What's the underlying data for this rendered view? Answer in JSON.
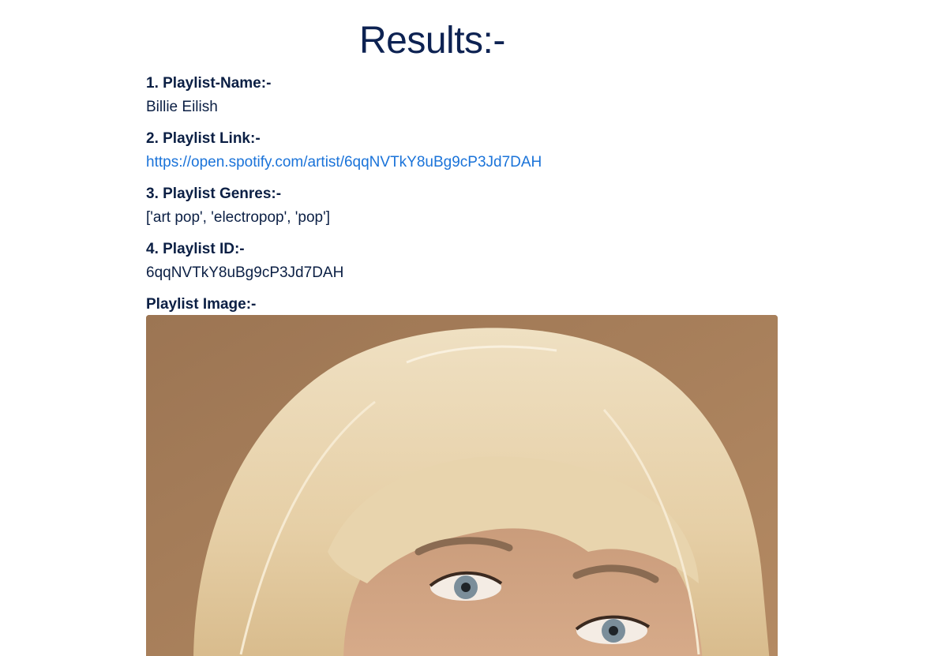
{
  "header": {
    "title": "Results:-"
  },
  "fields": [
    {
      "label": "1. Playlist-Name:-",
      "value": "Billie Eilish"
    },
    {
      "label": "2. Playlist Link:-",
      "value": "https://open.spotify.com/artist/6qqNVTkY8uBg9cP3Jd7DAH"
    },
    {
      "label": "3. Playlist Genres:-",
      "value": "['art pop', 'electropop', 'pop']"
    },
    {
      "label": "4. Playlist ID:-",
      "value": "6qqNVTkY8uBg9cP3Jd7DAH"
    }
  ],
  "image_section": {
    "label": "Playlist Image:-"
  },
  "colors": {
    "title": "#0d2252",
    "text": "#0b1f44",
    "link": "#1a73d9",
    "photo_background": "#a57e5b",
    "photo_hair": "#ead6b0"
  }
}
